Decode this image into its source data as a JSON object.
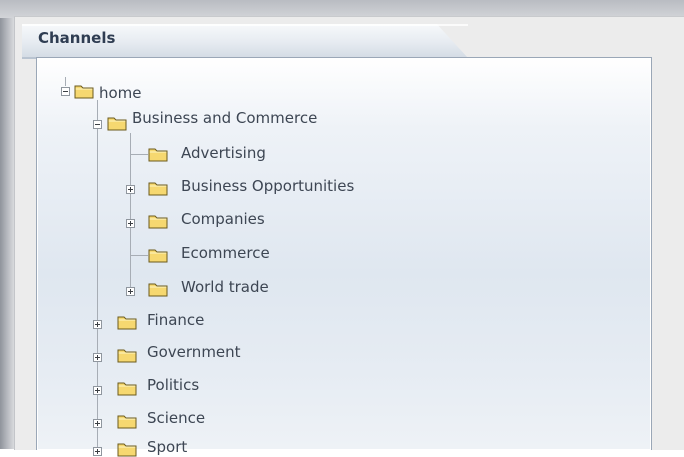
{
  "panel": {
    "title": "Channels"
  },
  "tree": {
    "root": "home",
    "level1": {
      "business": "Business and Commerce",
      "finance": "Finance",
      "government": "Government",
      "politics": "Politics",
      "science": "Science",
      "sport": "Sport"
    },
    "business_children": {
      "advertising": "Advertising",
      "opportunities": "Business Opportunities",
      "companies": "Companies",
      "ecommerce": "Ecommerce",
      "world_trade": "World trade"
    }
  },
  "colors": {
    "folder_fill": "#f6d870",
    "folder_border": "#6b5a1c",
    "text": "#3d4653",
    "panel_border": "#9aa7b7"
  },
  "icons": {
    "folder": "folder-icon",
    "expand": "plus-expander-icon",
    "collapse": "minus-expander-icon"
  }
}
